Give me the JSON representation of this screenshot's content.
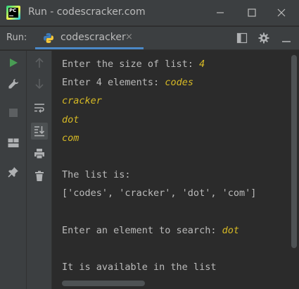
{
  "window": {
    "title": "Run - codescracker.com",
    "app_icon": "pycharm-icon",
    "controls": [
      "minimize-icon",
      "maximize-icon",
      "close-icon"
    ]
  },
  "run_panel": {
    "label": "Run:",
    "tab": {
      "icon": "python-icon",
      "label": "codescracker",
      "close": "×"
    },
    "right_tools": [
      "layout-icon",
      "gear-icon",
      "minimize-panel-icon"
    ]
  },
  "left_gutter": [
    "run-icon",
    "wrench-icon",
    "stop-icon",
    "layout-grid-icon",
    "pin-icon"
  ],
  "right_gutter": [
    "arrow-up-icon",
    "arrow-down-icon",
    "soft-wrap-icon",
    "scroll-to-end-icon",
    "print-icon",
    "trash-icon"
  ],
  "console": {
    "lines": [
      {
        "out": "Enter the size of list: ",
        "in": "4"
      },
      {
        "out": "Enter 4 elements: ",
        "in": "codes"
      },
      {
        "out": "",
        "in": "cracker"
      },
      {
        "out": "",
        "in": "dot"
      },
      {
        "out": "",
        "in": "com"
      },
      {
        "out": "",
        "in": ""
      },
      {
        "out": "The list is:",
        "in": ""
      },
      {
        "out": "['codes', 'cracker', 'dot', 'com']",
        "in": ""
      },
      {
        "out": "",
        "in": ""
      },
      {
        "out": "Enter an element to search: ",
        "in": "dot"
      },
      {
        "out": "",
        "in": ""
      },
      {
        "out": "It is available in the list",
        "in": ""
      }
    ]
  },
  "colors": {
    "background": "#2b2b2b",
    "panel": "#3c3f41",
    "output_text": "#bbbbbb",
    "input_text": "#d7ba25",
    "tab_underline": "#4a88c7",
    "run_green": "#499c54"
  }
}
